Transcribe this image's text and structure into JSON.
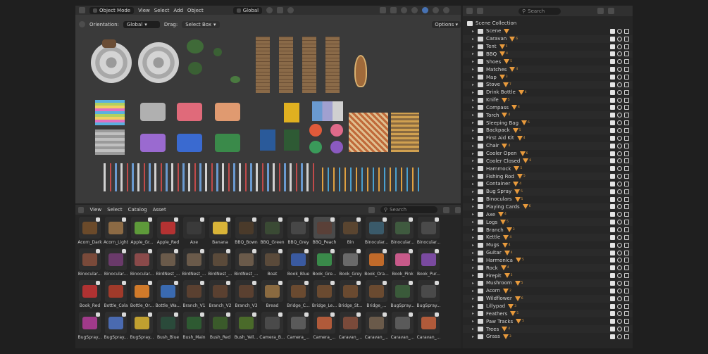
{
  "viewport": {
    "header": {
      "mode": "Object Mode",
      "menus": [
        "View",
        "Select",
        "Add",
        "Object"
      ],
      "transform": "Global"
    },
    "subheader": {
      "orientation_label": "Orientation:",
      "orientation_value": "Global",
      "drag_label": "Drag:",
      "drag_value": "Select Box",
      "options": "Options"
    }
  },
  "asset_browser": {
    "menus": [
      "View",
      "Select",
      "Catalog",
      "Asset"
    ],
    "search_placeholder": "Search",
    "assets": [
      {
        "label": "Acorn_Dark",
        "color": "#6b4a2a"
      },
      {
        "label": "Acorn_Light",
        "color": "#8c6a44"
      },
      {
        "label": "Apple_Gr...",
        "color": "#5e9a3a"
      },
      {
        "label": "Apple_Red",
        "color": "#b43232"
      },
      {
        "label": "Axe",
        "color": "#3a3a3a"
      },
      {
        "label": "Banana",
        "color": "#d9b438"
      },
      {
        "label": "BBQ_Bown",
        "color": "#4a3a2a"
      },
      {
        "label": "BBQ_Green",
        "color": "#3a4a34"
      },
      {
        "label": "BBQ_Grey",
        "color": "#474747"
      },
      {
        "label": "BBQ_Peach",
        "color": "#5a4038"
      },
      {
        "label": "Bin",
        "color": "#5a4530"
      },
      {
        "label": "Binocular...",
        "color": "#3a5a6a"
      },
      {
        "label": "Binocular...",
        "color": "#3f5a3f"
      },
      {
        "label": "Binocular...",
        "color": "#4a4a4a"
      },
      {
        "label": "Binocular...",
        "color": "#7a4a3a"
      },
      {
        "label": "Binocular...",
        "color": "#6a3a6a"
      },
      {
        "label": "Binocular...",
        "color": "#8a4a4a"
      },
      {
        "label": "BirdNest_...",
        "color": "#6a5a4a"
      },
      {
        "label": "BirdNest_...",
        "color": "#6a5a4a"
      },
      {
        "label": "BirdNest_...",
        "color": "#5a4a3a"
      },
      {
        "label": "BirdNest_...",
        "color": "#6a5a4a"
      },
      {
        "label": "Boat",
        "color": "#5a4a3a"
      },
      {
        "label": "Book_Blue",
        "color": "#3a5aa0"
      },
      {
        "label": "Book_Gre...",
        "color": "#3a8a4a"
      },
      {
        "label": "Book_Grey",
        "color": "#6a6a6a"
      },
      {
        "label": "Book_Ora...",
        "color": "#c06a2a"
      },
      {
        "label": "Book_Pink",
        "color": "#c85a8a"
      },
      {
        "label": "Book_Pur...",
        "color": "#7a4aa0"
      },
      {
        "label": "Book_Red",
        "color": "#b03232"
      },
      {
        "label": "Bottle_Cola",
        "color": "#a03a2a"
      },
      {
        "label": "Bottle_Or...",
        "color": "#d07a2a"
      },
      {
        "label": "Bottle_Wa...",
        "color": "#3a6ab0"
      },
      {
        "label": "Branch_V1",
        "color": "#5a4030"
      },
      {
        "label": "Branch_V2",
        "color": "#5a4030"
      },
      {
        "label": "Branch_V3",
        "color": "#5a4030"
      },
      {
        "label": "Bread",
        "color": "#8a6a40"
      },
      {
        "label": "Bridge_C...",
        "color": "#6a4a30"
      },
      {
        "label": "Bridge_Le...",
        "color": "#6a4a30"
      },
      {
        "label": "Bridge_St...",
        "color": "#6a4a30"
      },
      {
        "label": "Bridge_...",
        "color": "#6a4a30"
      },
      {
        "label": "BugSpray...",
        "color": "#3a5a3a"
      },
      {
        "label": "BugSpray...",
        "color": "#4a4a4a"
      },
      {
        "label": "BugSpray...",
        "color": "#a03a8a"
      },
      {
        "label": "BugSpray...",
        "color": "#4a6ab0"
      },
      {
        "label": "BugSpray...",
        "color": "#c0a030"
      },
      {
        "label": "Bush_Blue",
        "color": "#2a4a3a"
      },
      {
        "label": "Bush_Main",
        "color": "#2e5a32"
      },
      {
        "label": "Bush_Red",
        "color": "#3a5a2a"
      },
      {
        "label": "Bush_Yell...",
        "color": "#4a6a2a"
      },
      {
        "label": "Camera_B...",
        "color": "#4a4a4a"
      },
      {
        "label": "Camera_...",
        "color": "#5a5a5a"
      },
      {
        "label": "Camera_...",
        "color": "#b05a3a"
      },
      {
        "label": "Caravan_...",
        "color": "#7a4a3a"
      },
      {
        "label": "Caravan_...",
        "color": "#6a5a4a"
      },
      {
        "label": "Caravan_...",
        "color": "#5a5a5a"
      },
      {
        "label": "Caravan_...",
        "color": "#b05a3a"
      }
    ]
  },
  "outliner": {
    "search_placeholder": "Search",
    "root": "Scene Collection",
    "items": [
      {
        "name": "Scene",
        "icon": "collection",
        "count": ""
      },
      {
        "name": "Caravan",
        "icon": "collection",
        "count": "6"
      },
      {
        "name": "Tent",
        "icon": "collection",
        "count": "5"
      },
      {
        "name": "BBQ",
        "icon": "collection",
        "count": "4"
      },
      {
        "name": "Shoes",
        "icon": "collection",
        "count": "5"
      },
      {
        "name": "Matches",
        "icon": "collection",
        "count": "4"
      },
      {
        "name": "Map",
        "icon": "collection",
        "count": "3"
      },
      {
        "name": "Stove",
        "icon": "collection",
        "count": "7"
      },
      {
        "name": "Drink Bottle",
        "icon": "collection",
        "count": "4"
      },
      {
        "name": "Knife",
        "icon": "collection",
        "count": "5"
      },
      {
        "name": "Compass",
        "icon": "collection",
        "count": "4"
      },
      {
        "name": "Torch",
        "icon": "collection",
        "count": "4"
      },
      {
        "name": "Sleeping Bag",
        "icon": "collection",
        "count": "6"
      },
      {
        "name": "Backpack",
        "icon": "collection",
        "count": "5"
      },
      {
        "name": "First Aid Kit",
        "icon": "collection",
        "count": "4"
      },
      {
        "name": "Chair",
        "icon": "collection",
        "count": "4"
      },
      {
        "name": "Cooler Open",
        "icon": "collection",
        "count": "6"
      },
      {
        "name": "Cooler Closed",
        "icon": "collection",
        "count": "6"
      },
      {
        "name": "Hammock",
        "icon": "collection",
        "count": "5"
      },
      {
        "name": "Fishing Rod",
        "icon": "collection",
        "count": "5"
      },
      {
        "name": "Container",
        "icon": "collection",
        "count": "4"
      },
      {
        "name": "Bug Spray",
        "icon": "collection",
        "count": "5"
      },
      {
        "name": "Binoculars",
        "icon": "collection",
        "count": "5"
      },
      {
        "name": "Playing Cards",
        "icon": "collection",
        "count": "6"
      },
      {
        "name": "Axe",
        "icon": "collection",
        "count": "4"
      },
      {
        "name": "Logs",
        "icon": "collection",
        "count": "5"
      },
      {
        "name": "Branch",
        "icon": "collection",
        "count": "3"
      },
      {
        "name": "Kettle",
        "icon": "collection",
        "count": "4"
      },
      {
        "name": "Mugs",
        "icon": "collection",
        "count": "4"
      },
      {
        "name": "Guitar",
        "icon": "collection",
        "count": "4"
      },
      {
        "name": "Harmonica",
        "icon": "collection",
        "count": "5"
      },
      {
        "name": "Rock",
        "icon": "collection",
        "count": "4"
      },
      {
        "name": "Firepit",
        "icon": "collection",
        "count": "3"
      },
      {
        "name": "Mushroom",
        "icon": "collection",
        "count": "5"
      },
      {
        "name": "Acorn",
        "icon": "collection",
        "count": "2"
      },
      {
        "name": "Wildflower",
        "icon": "collection",
        "count": "6"
      },
      {
        "name": "Lillypad",
        "icon": "collection",
        "count": "3"
      },
      {
        "name": "Feathers",
        "icon": "collection",
        "count": "5"
      },
      {
        "name": "Paw Tracks",
        "icon": "collection",
        "count": "5"
      },
      {
        "name": "Trees",
        "icon": "collection",
        "count": "4"
      },
      {
        "name": "Grass",
        "icon": "collection",
        "count": "3"
      }
    ]
  }
}
